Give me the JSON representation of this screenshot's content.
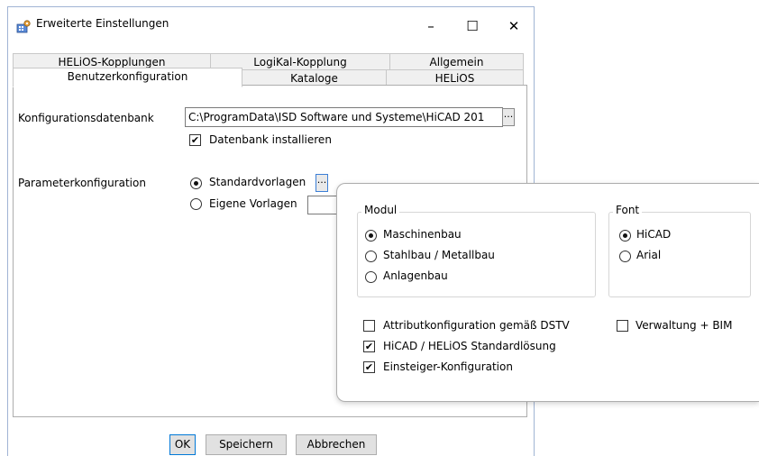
{
  "window": {
    "title": "Erweiterte Einstellungen",
    "controls": {
      "minimize": "–",
      "maximize": "☐",
      "close": "✕"
    }
  },
  "tabs": {
    "row1": [
      "HELiOS-Kopplungen",
      "LogiKal-Kopplung",
      "Allgemein"
    ],
    "row2": [
      "Benutzerkonfiguration",
      "Kataloge",
      "HELiOS"
    ],
    "active": "Benutzerkonfiguration"
  },
  "panel": {
    "konfig_db_label": "Konfigurationsdatenbank",
    "konfig_db_value": "C:\\ProgramData\\ISD Software und Systeme\\HiCAD 201",
    "browse_label": "...",
    "datenbank_install_label": "Datenbank installieren",
    "datenbank_install_checked": true,
    "param_label": "Parameterkonfiguration",
    "standard_label": "Standardvorlagen",
    "standard_selected": true,
    "eigene_label": "Eigene Vorlagen",
    "eigene_selected": false
  },
  "popup": {
    "modul": {
      "title": "Modul",
      "options": [
        {
          "label": "Maschinenbau",
          "selected": true
        },
        {
          "label": "Stahlbau / Metallbau",
          "selected": false
        },
        {
          "label": "Anlagenbau",
          "selected": false
        }
      ]
    },
    "font": {
      "title": "Font",
      "options": [
        {
          "label": "HiCAD",
          "selected": true
        },
        {
          "label": "Arial",
          "selected": false
        }
      ]
    },
    "checks": [
      {
        "label": "Attributkonfiguration gemäß DSTV",
        "checked": false
      },
      {
        "label": "HiCAD / HELiOS Standardlösung",
        "checked": true
      },
      {
        "label": "Einsteiger-Konfiguration",
        "checked": true
      }
    ],
    "verwaltung": {
      "label": "Verwaltung + BIM",
      "checked": false
    }
  },
  "buttons": {
    "ok": "OK",
    "speichern": "Speichern",
    "abbrechen": "Abbrechen"
  },
  "colors": {
    "window_border": "#a0b4d4",
    "tab_bg": "#f0f0f0",
    "button_bg": "#e1e1e1"
  }
}
